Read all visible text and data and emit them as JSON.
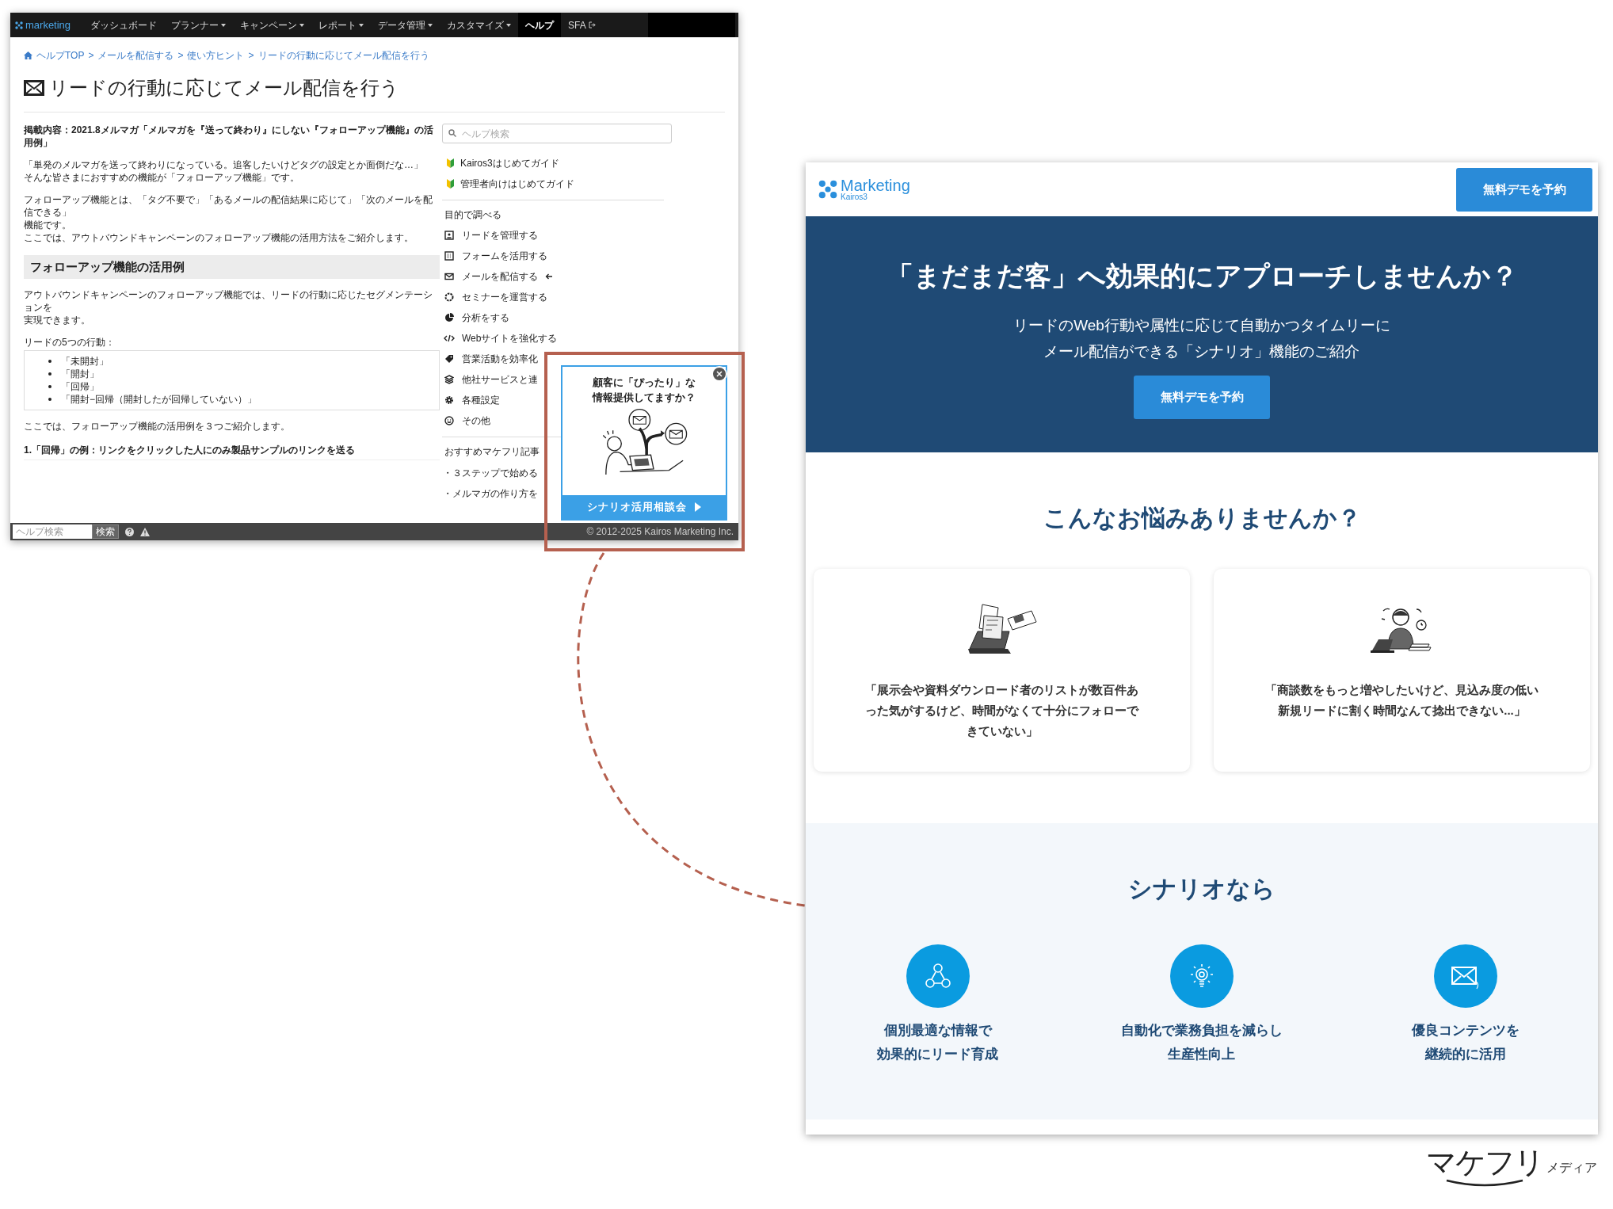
{
  "left_window": {
    "nav": {
      "logo": "marketing",
      "items": [
        {
          "label": "ダッシュボード",
          "kind": "plain",
          "selected": false
        },
        {
          "label": "プランナー",
          "kind": "menu",
          "selected": false
        },
        {
          "label": "キャンペーン",
          "kind": "menu",
          "selected": false
        },
        {
          "label": "レポート",
          "kind": "menu",
          "selected": false
        },
        {
          "label": "データ管理",
          "kind": "menu",
          "selected": false
        },
        {
          "label": "カスタマイズ",
          "kind": "menu",
          "selected": false
        },
        {
          "label": "ヘルプ",
          "kind": "plain",
          "selected": true
        },
        {
          "label": "SFA",
          "kind": "exit",
          "selected": false
        }
      ]
    },
    "breadcrumb": {
      "separator": ">",
      "items": [
        "ヘルプTOP",
        "メールを配信する",
        "使い方ヒント",
        "リードの行動に応じてメール配信を行う"
      ]
    },
    "title": "リードの行動に応じてメール配信を行う",
    "article": [
      {
        "kind": "lead",
        "text": "掲載内容：2021.8メルマガ「メルマガを『送って終わり』にしない『フォローアップ機能』の活用例」"
      },
      {
        "kind": "paragraph",
        "lines": [
          "「単発のメルマガを送って終わりになっている。追客したいけどタグの設定とか面倒だな…」",
          "そんな皆さまにおすすめの機能が「フォローアップ機能」です。"
        ]
      },
      {
        "kind": "paragraph",
        "lines": [
          "フォローアップ機能とは、「タグ不要で」「あるメールの配信結果に応じて」「次のメールを配信できる」",
          "機能です。",
          "ここでは、アウトバウンドキャンペーンのフォローアップ機能の活用方法をご紹介します。"
        ]
      },
      {
        "kind": "section",
        "text": "フォローアップ機能の活用例"
      },
      {
        "kind": "paragraph",
        "lines": [
          "アウトバウンドキャンペーンのフォローアップ機能では、リードの行動に応じたセグメンテーションを",
          "実現できます。"
        ]
      },
      {
        "kind": "paragraph",
        "lines": [
          "リードの5つの行動："
        ]
      },
      {
        "kind": "list",
        "items": [
          "「未開封」",
          "「開封」",
          "「回帰」",
          "「開封−回帰（開封したが回帰していない）」"
        ]
      },
      {
        "kind": "paragraph",
        "lines": [
          "ここでは、フォローアップ機能の活用例を３つご紹介します。"
        ]
      },
      {
        "kind": "subheading",
        "text": "1.「回帰」の例：リンクをクリックした人にのみ製品サンプルのリンクを送る"
      }
    ],
    "sidebar": {
      "search_placeholder": "ヘルプ検索",
      "guides": [
        "Kairos3はじめてガイド",
        "管理者向けはじめてガイド"
      ],
      "purpose_heading": "目的で調べる",
      "purposes": [
        {
          "label": "リードを管理する",
          "current": false
        },
        {
          "label": "フォームを活用する",
          "current": false
        },
        {
          "label": "メールを配信する",
          "current": true
        },
        {
          "label": "セミナーを運営する",
          "current": false
        },
        {
          "label": "分析をする",
          "current": false
        },
        {
          "label": "Webサイトを強化する",
          "current": false
        },
        {
          "label": "営業活動を効率化",
          "current": false
        },
        {
          "label": "他社サービスと連",
          "current": false
        },
        {
          "label": "各種設定",
          "current": false
        },
        {
          "label": "その他",
          "current": false
        }
      ],
      "articles_heading": "おすすめマケフリ記事",
      "articles": [
        "・３ステップで始める",
        "・メルマガの作り方を"
      ]
    },
    "footer": {
      "search_placeholder": "ヘルプ検索",
      "search_button": "検索",
      "copyright": "© 2012-2025 Kairos Marketing Inc."
    },
    "popup": {
      "title_lines": [
        "顧客に「ぴったり」な",
        "情報提供してますか？"
      ],
      "button": "シナリオ活用相談会"
    }
  },
  "right_window": {
    "header": {
      "logo": "Marketing",
      "logo_sub": "Kairos3",
      "cta": "無料デモを予約"
    },
    "hero": {
      "title": "「まだまだ客」へ効果的にアプローチしませんか？",
      "subtitle_lines": [
        "リードのWeb行動や属性に応じて自動かつタイムリーに",
        "メール配信ができる「シナリオ」機能のご紹介"
      ],
      "cta": "無料デモを予約"
    },
    "problems": {
      "heading": "こんなお悩みありませんか？",
      "cards": [
        {
          "text": "「展示会や資料ダウンロード者のリストが数百件あった気がするけど、時間がなくて十分にフォローできていない」"
        },
        {
          "text": "「商談数をもっと増やしたいけど、見込み度の低い新規リードに割く時間なんて捻出できない...」"
        }
      ]
    },
    "benefits": {
      "heading": "シナリオなら",
      "items": [
        {
          "lines": [
            "個別最適な情報で",
            "効果的にリード育成"
          ]
        },
        {
          "lines": [
            "自動化で業務負担を減らし",
            "生産性向上"
          ]
        },
        {
          "lines": [
            "優良コンテンツを",
            "継続的に活用"
          ]
        }
      ]
    }
  },
  "brand": {
    "name": "マケフリ",
    "sub": "メディア"
  }
}
